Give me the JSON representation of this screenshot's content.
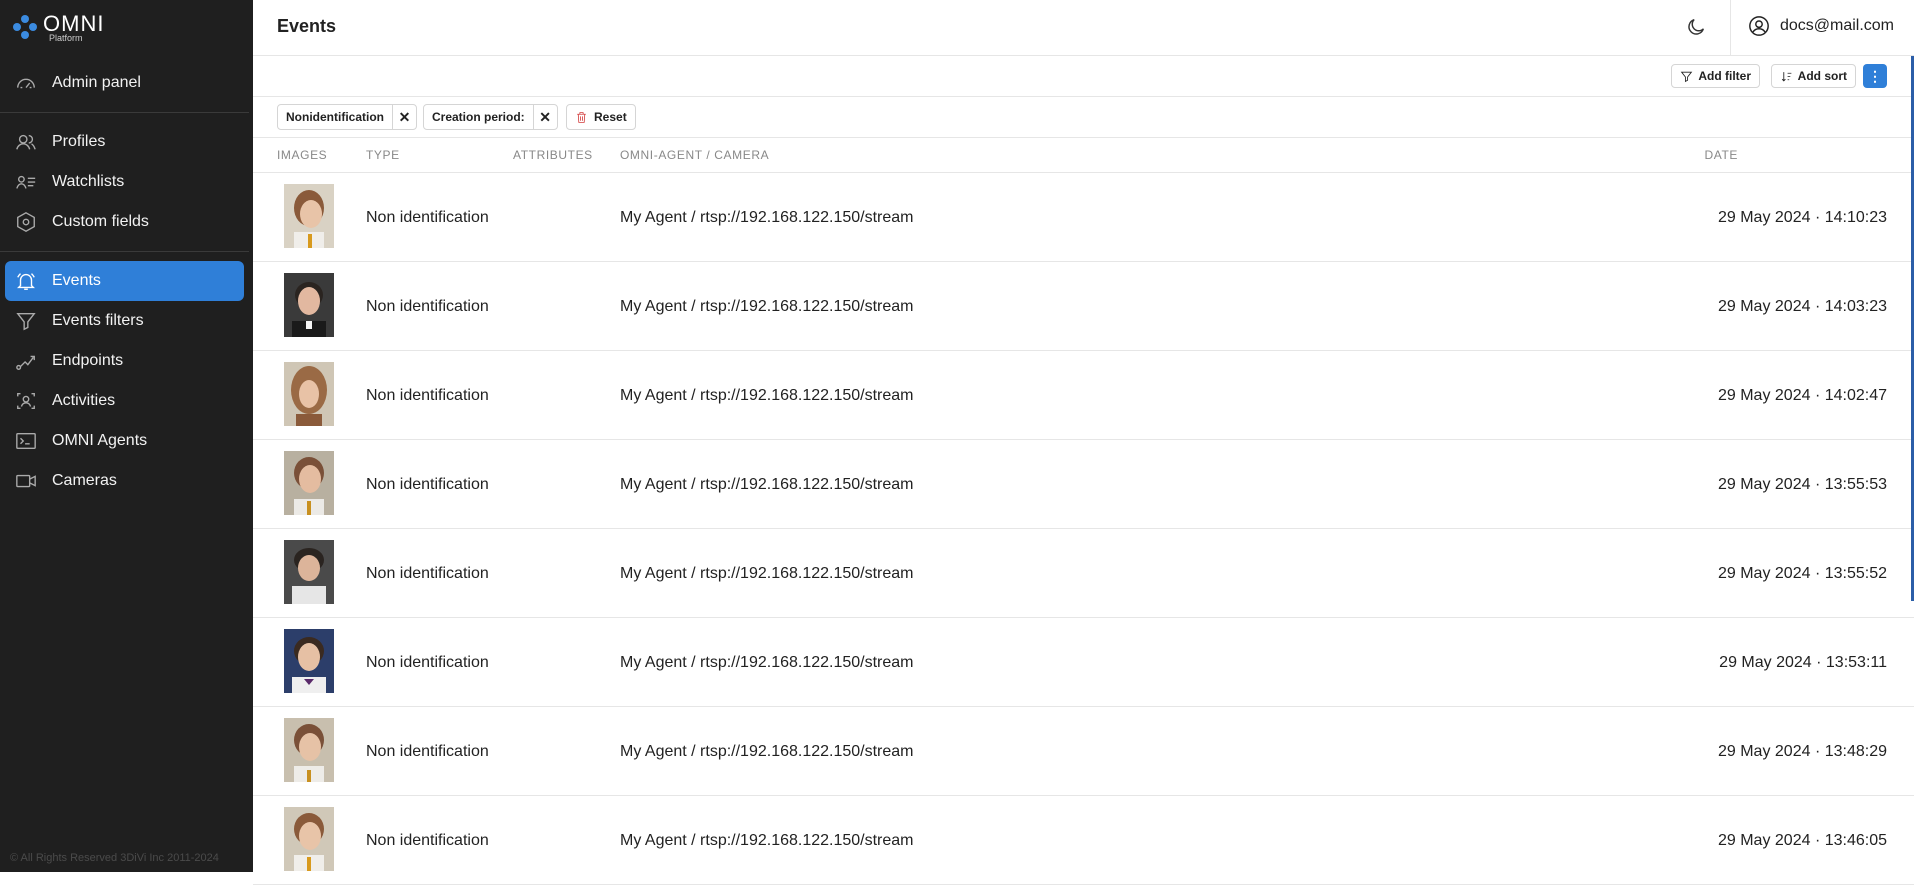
{
  "brand": {
    "name": "OMNI",
    "subtitle": "Platform",
    "accent": "#2f7fd8"
  },
  "sidebar": {
    "items": [
      {
        "label": "Admin panel",
        "icon": "gauge-icon"
      },
      {
        "label": "Profiles",
        "icon": "users-icon"
      },
      {
        "label": "Watchlists",
        "icon": "user-list-icon"
      },
      {
        "label": "Custom fields",
        "icon": "hexagon-icon"
      },
      {
        "label": "Events",
        "icon": "bell-icon",
        "active": true
      },
      {
        "label": "Events filters",
        "icon": "filter-icon"
      },
      {
        "label": "Endpoints",
        "icon": "endpoint-icon"
      },
      {
        "label": "Activities",
        "icon": "scan-user-icon"
      },
      {
        "label": "OMNI Agents",
        "icon": "terminal-icon"
      },
      {
        "label": "Cameras",
        "icon": "camera-icon"
      }
    ],
    "copyright": "© All Rights Reserved 3DiVi Inc 2011-2024"
  },
  "header": {
    "title": "Events",
    "user_email": "docs@mail.com"
  },
  "toolbar": {
    "add_filter": "Add filter",
    "add_sort": "Add sort",
    "more": "⋮"
  },
  "filters": {
    "chips": [
      "Nonidentification",
      "Creation period:"
    ],
    "reset": "Reset"
  },
  "table": {
    "columns": [
      "IMAGES",
      "TYPE",
      "ATTRIBUTES",
      "OMNI-AGENT / CAMERA",
      "DATE"
    ],
    "rows": [
      {
        "type": "Non identification",
        "camera": "My Agent / rtsp://192.168.122.150/stream",
        "date": "29 May 2024 · 14:10:23"
      },
      {
        "type": "Non identification",
        "camera": "My Agent / rtsp://192.168.122.150/stream",
        "date": "29 May 2024 · 14:03:23"
      },
      {
        "type": "Non identification",
        "camera": "My Agent / rtsp://192.168.122.150/stream",
        "date": "29 May 2024 · 14:02:47"
      },
      {
        "type": "Non identification",
        "camera": "My Agent / rtsp://192.168.122.150/stream",
        "date": "29 May 2024 · 13:55:53"
      },
      {
        "type": "Non identification",
        "camera": "My Agent / rtsp://192.168.122.150/stream",
        "date": "29 May 2024 · 13:55:52"
      },
      {
        "type": "Non identification",
        "camera": "My Agent / rtsp://192.168.122.150/stream",
        "date": "29 May 2024 · 13:53:11"
      },
      {
        "type": "Non identification",
        "camera": "My Agent / rtsp://192.168.122.150/stream",
        "date": "29 May 2024 · 13:48:29"
      },
      {
        "type": "Non identification",
        "camera": "My Agent / rtsp://192.168.122.150/stream",
        "date": "29 May 2024 · 13:46:05"
      }
    ]
  }
}
